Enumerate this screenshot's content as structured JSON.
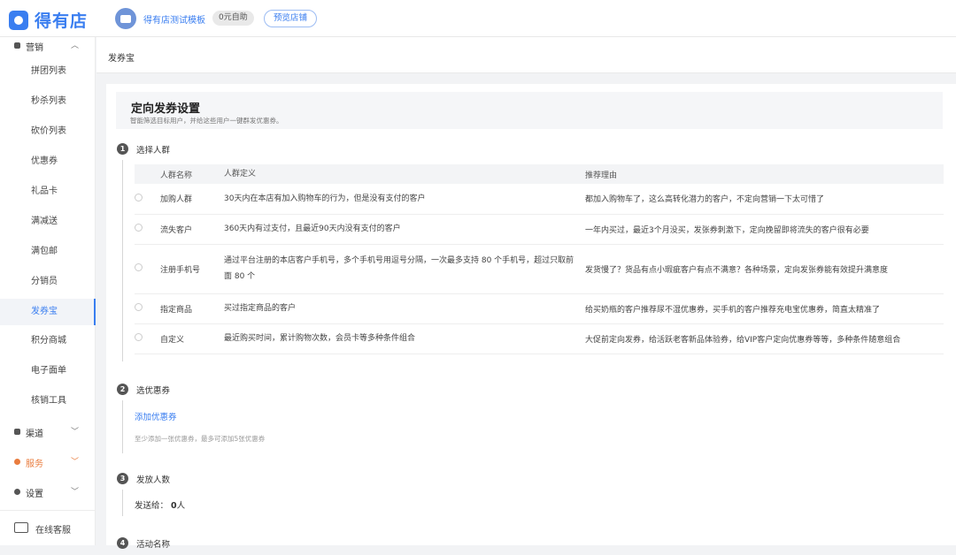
{
  "topbar": {
    "logo_text": "得有店",
    "store_name": "得有店测试模板",
    "plan_badge": "0元自助",
    "preview_button": "预览店铺"
  },
  "sidebar": {
    "marketing_label": "营销",
    "items": [
      {
        "label": "拼团列表",
        "active": false
      },
      {
        "label": "秒杀列表",
        "active": false
      },
      {
        "label": "砍价列表",
        "active": false
      },
      {
        "label": "优惠券",
        "active": false
      },
      {
        "label": "礼品卡",
        "active": false
      },
      {
        "label": "满减送",
        "active": false
      },
      {
        "label": "满包邮",
        "active": false
      },
      {
        "label": "分销员",
        "active": false
      },
      {
        "label": "发券宝",
        "active": true
      },
      {
        "label": "积分商城",
        "active": false
      },
      {
        "label": "电子面单",
        "active": false
      },
      {
        "label": "核销工具",
        "active": false
      }
    ],
    "groups": {
      "channel": "渠道",
      "service": "服务",
      "settings": "设置"
    },
    "support": "在线客服"
  },
  "breadcrumb": "发券宝",
  "panel": {
    "title": "定向发券设置",
    "subtitle": "智能筛选目标用户，并给这些用户一键群发优惠券。"
  },
  "step1": {
    "number": "1",
    "label": "选择人群",
    "columns": [
      "人群名称",
      "人群定义",
      "推荐理由"
    ],
    "rows": [
      {
        "name": "加购人群",
        "definition": "30天内在本店有加入购物车的行为，但是没有支付的客户",
        "reason": "都加入购物车了，这么高转化潜力的客户，不定向营销一下太可惜了"
      },
      {
        "name": "流失客户",
        "definition": "360天内有过支付，且最近90天内没有支付的客户",
        "reason": "一年内买过，最近3个月没买，发张券刺激下，定向挽留即将流失的客户很有必要"
      },
      {
        "name": "注册手机号",
        "definition": "通过平台注册的本店客户手机号，多个手机号用逗号分隔，一次最多支持 80 个手机号，超过只取前面 80 个",
        "reason": "发货慢了？货品有点小瑕疵客户有点不满意？各种场景，定向发张券能有效提升满意度"
      },
      {
        "name": "指定商品",
        "definition": "买过指定商品的客户",
        "reason": "给买奶瓶的客户推荐尿不湿优惠券，买手机的客户推荐充电宝优惠券，简直太精准了"
      },
      {
        "name": "自定义",
        "definition": "最近购买时间，累计购物次数，会员卡等多种条件组合",
        "reason": "大促前定向发券，给活跃老客新品体验券，给VIP客户定向优惠券等等，多种条件随意组合"
      }
    ]
  },
  "step2": {
    "number": "2",
    "label": "选优惠券",
    "add_link": "添加优惠券",
    "hint": "至少添加一张优惠券，最多可添加5张优惠券"
  },
  "step3": {
    "number": "3",
    "label": "发放人数",
    "send_prefix": "发送给：",
    "send_count": "0",
    "send_unit": "人"
  },
  "step4": {
    "number": "4",
    "label": "活动名称"
  }
}
